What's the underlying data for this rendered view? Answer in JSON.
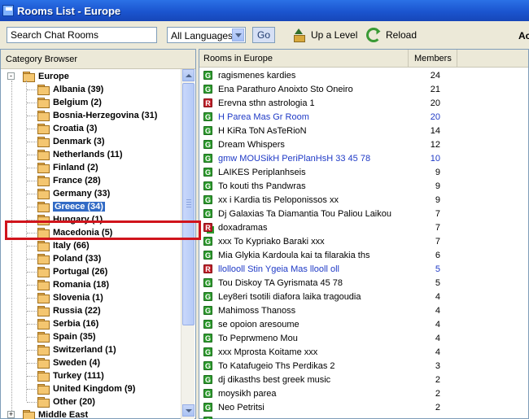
{
  "window": {
    "title": "Rooms List - Europe"
  },
  "toolbar": {
    "search_placeholder": "Search Chat Rooms",
    "language": "All Languages",
    "go_label": "Go",
    "up_level_label": "Up a Level",
    "reload_label": "Reload",
    "account_label": "Ac"
  },
  "category_browser": {
    "title": "Category Browser",
    "root": {
      "label": "Europe",
      "expander": "-"
    },
    "items": [
      {
        "label": "Albania (39)"
      },
      {
        "label": "Belgium (2)"
      },
      {
        "label": "Bosnia-Herzegovina (31)"
      },
      {
        "label": "Croatia (3)"
      },
      {
        "label": "Denmark (3)"
      },
      {
        "label": "Netherlands (11)"
      },
      {
        "label": "Finland (2)"
      },
      {
        "label": "France (28)"
      },
      {
        "label": "Germany (33)"
      },
      {
        "label": "Greece (34)",
        "selected": true
      },
      {
        "label": "Hungary (1)"
      },
      {
        "label": "Macedonia (5)"
      },
      {
        "label": "Italy (66)"
      },
      {
        "label": "Poland (33)"
      },
      {
        "label": "Portugal (26)"
      },
      {
        "label": "Romania (18)"
      },
      {
        "label": "Slovenia (1)"
      },
      {
        "label": "Russia (22)"
      },
      {
        "label": "Serbia (16)"
      },
      {
        "label": "Spain (35)"
      },
      {
        "label": "Switzerland (1)"
      },
      {
        "label": "Sweden (4)"
      },
      {
        "label": "Turkey (111)"
      },
      {
        "label": "United Kingdom (9)"
      },
      {
        "label": "Other (20)"
      }
    ],
    "sibling": {
      "label": "Middle East",
      "expander": "+"
    }
  },
  "rooms": {
    "header_name": "Rooms in Europe",
    "header_members": "Members",
    "list": [
      {
        "badge": "G",
        "name": "ragismenes kardies",
        "members": "24",
        "blue": false
      },
      {
        "badge": "G",
        "name": "Ena Parathuro Anoixto Sto Oneiro",
        "members": "21",
        "blue": false
      },
      {
        "badge": "R",
        "name": "Erevna sthn astrologia 1",
        "members": "20",
        "blue": false
      },
      {
        "badge": "G",
        "name": "H Parea Mas Gr Room",
        "members": "20",
        "blue": true
      },
      {
        "badge": "G",
        "name": "H KiRa ToN AsTeRioN",
        "members": "14",
        "blue": false
      },
      {
        "badge": "G",
        "name": "Dream Whispers",
        "members": "12",
        "blue": false
      },
      {
        "badge": "G",
        "name": "gmw MOUSikH PeriPlanHsH 33 45 78",
        "members": "10",
        "blue": true
      },
      {
        "badge": "G",
        "name": "LAIKES Periplanhseis",
        "members": "9",
        "blue": false
      },
      {
        "badge": "G",
        "name": "To kouti ths Pandwras",
        "members": "9",
        "blue": false
      },
      {
        "badge": "G",
        "name": "xx i Kardia tis Peloponissos xx",
        "members": "9",
        "blue": false
      },
      {
        "badge": "G",
        "name": "Dj Galaxias Ta Diamantia Tou Paliou Laikou",
        "members": "7",
        "blue": false
      },
      {
        "badge": "RG",
        "name": "doxadramas",
        "members": "7",
        "blue": false
      },
      {
        "badge": "G",
        "name": "xxx To Kypriako Baraki xxx",
        "members": "7",
        "blue": false
      },
      {
        "badge": "G",
        "name": "Mia Glykia Kardoula kai ta filarakia ths",
        "members": "6",
        "blue": false
      },
      {
        "badge": "R",
        "name": "llollooll Stin Ygeia Mas llooll oll",
        "members": "5",
        "blue": true
      },
      {
        "badge": "G",
        "name": "Tou Diskoy TA Gyrismata 45 78",
        "members": "5",
        "blue": false
      },
      {
        "badge": "G",
        "name": "Ley8eri tsotili diafora laika tragoudia",
        "members": "4",
        "blue": false
      },
      {
        "badge": "G",
        "name": "Mahimoss Thanoss",
        "members": "4",
        "blue": false
      },
      {
        "badge": "G",
        "name": "se opoion aresoume",
        "members": "4",
        "blue": false
      },
      {
        "badge": "G",
        "name": "To Peprwmeno Mou",
        "members": "4",
        "blue": false
      },
      {
        "badge": "G",
        "name": "xxx Mprosta Koitame xxx",
        "members": "4",
        "blue": false
      },
      {
        "badge": "G",
        "name": "To Katafugeio Ths Perdikas 2",
        "members": "3",
        "blue": false
      },
      {
        "badge": "G",
        "name": "dj dikasths best greek music",
        "members": "2",
        "blue": false
      },
      {
        "badge": "G",
        "name": "moysikh parea",
        "members": "2",
        "blue": false
      },
      {
        "badge": "G",
        "name": "Neo Petritsi",
        "members": "2",
        "blue": false
      },
      {
        "badge": "G",
        "name": "",
        "members": "",
        "blue": false
      }
    ]
  }
}
